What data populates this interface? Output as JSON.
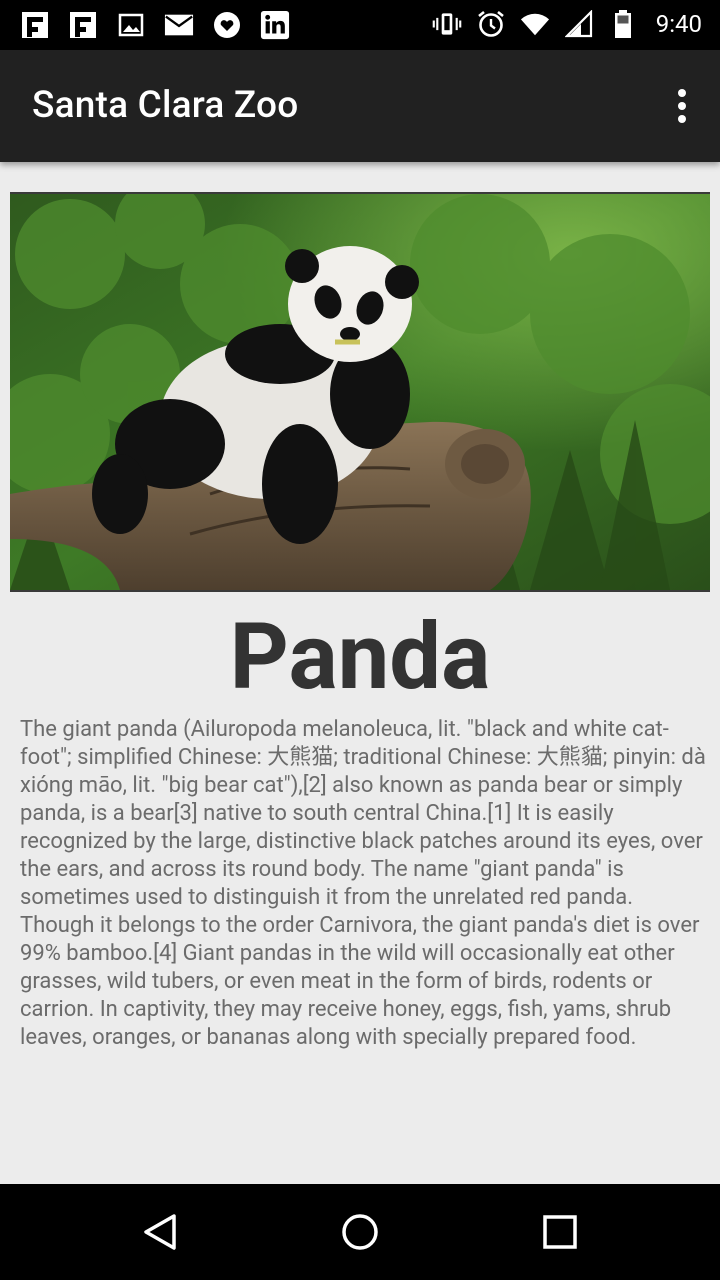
{
  "status_bar": {
    "time": "9:40",
    "left_icons": [
      "flipboard-icon",
      "flipboard-icon",
      "image-icon",
      "mail-icon",
      "heart-message-icon",
      "linkedin-icon"
    ],
    "right_icons": [
      "vibrate-icon",
      "alarm-icon",
      "wifi-icon",
      "signal-icon",
      "battery-icon"
    ]
  },
  "app_bar": {
    "title": "Santa Clara Zoo"
  },
  "animal": {
    "name": "Panda",
    "description": "The giant panda (Ailuropoda melanoleuca, lit. \"black and white cat-foot\"; simplified Chinese: 大熊猫; traditional Chinese: 大熊貓; pinyin: dà xióng māo, lit. \"big bear cat\"),[2] also known as panda bear or simply panda, is a bear[3] native to south central China.[1] It is easily recognized by the large, distinctive black patches around its eyes, over the ears, and across its round body. The name \"giant panda\" is sometimes used to distinguish it from the unrelated red panda. Though it belongs to the order Carnivora, the giant panda's diet is over 99% bamboo.[4] Giant pandas in the wild will occasionally eat other grasses, wild tubers, or even meat in the form of birds, rodents or carrion. In captivity, they may receive honey, eggs, fish, yams, shrub leaves, oranges, or bananas along with specially prepared food."
  },
  "navigation": {
    "back": "back-icon",
    "home": "home-icon",
    "recents": "recents-icon"
  }
}
